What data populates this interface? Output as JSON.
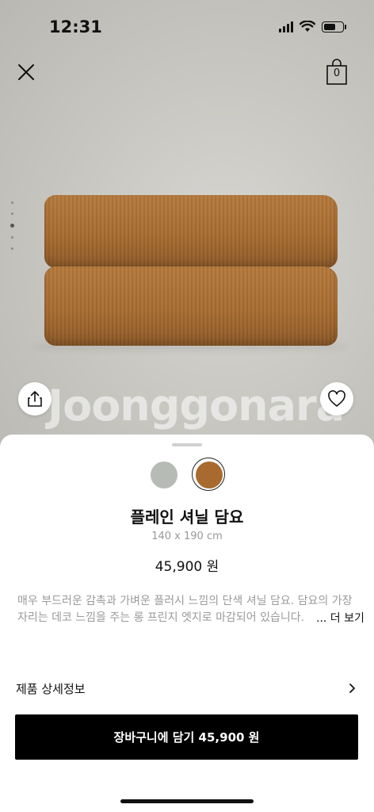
{
  "status_bar": {
    "time": "12:31"
  },
  "header": {
    "bag_count": "0"
  },
  "gallery": {
    "watermark": "Joonggonara"
  },
  "product": {
    "title": "플레인 셔닐 담요",
    "size": "140 x 190 cm",
    "price": "45,900 원",
    "description": "매우 부드러운 감촉과 가벼운 플러시 느낌의 단색 셔닐 담요. 담요의 가장자리는 데코 느낌을 주는 롱 프린지 엣지로 마감되어 있습니다.",
    "more_label": "... 더 보기",
    "colors": [
      {
        "name": "grey",
        "hex": "#b6bcb5"
      },
      {
        "name": "ochre",
        "hex": "#a86a2e",
        "selected": true
      }
    ]
  },
  "details": {
    "label": "제품 상세정보"
  },
  "cart_button": {
    "label": "장바구니에 담기 45,900 원"
  }
}
